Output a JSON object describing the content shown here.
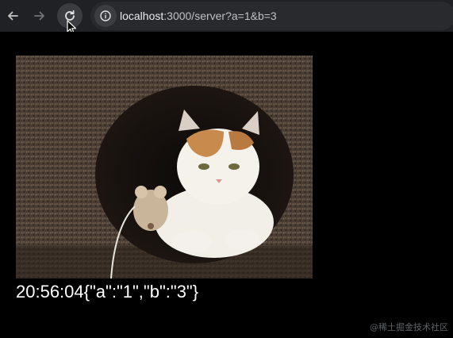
{
  "browser": {
    "url_host": "localhost",
    "url_rest": ":3000/server?a=1&b=3"
  },
  "icons": {
    "back": "back-arrow-icon",
    "forward": "forward-arrow-icon",
    "reload": "reload-icon",
    "site_info": "info-icon",
    "cursor": "mouse-pointer-icon"
  },
  "page": {
    "output": "20:56:04{\"a\":\"1\",\"b\":\"3\"}"
  },
  "watermark": "@稀土掘金技术社区",
  "colors": {
    "toolbar_bg": "#202124",
    "omnibox_bg": "#282a2d",
    "page_bg": "#000000",
    "text": "#ffffff"
  }
}
